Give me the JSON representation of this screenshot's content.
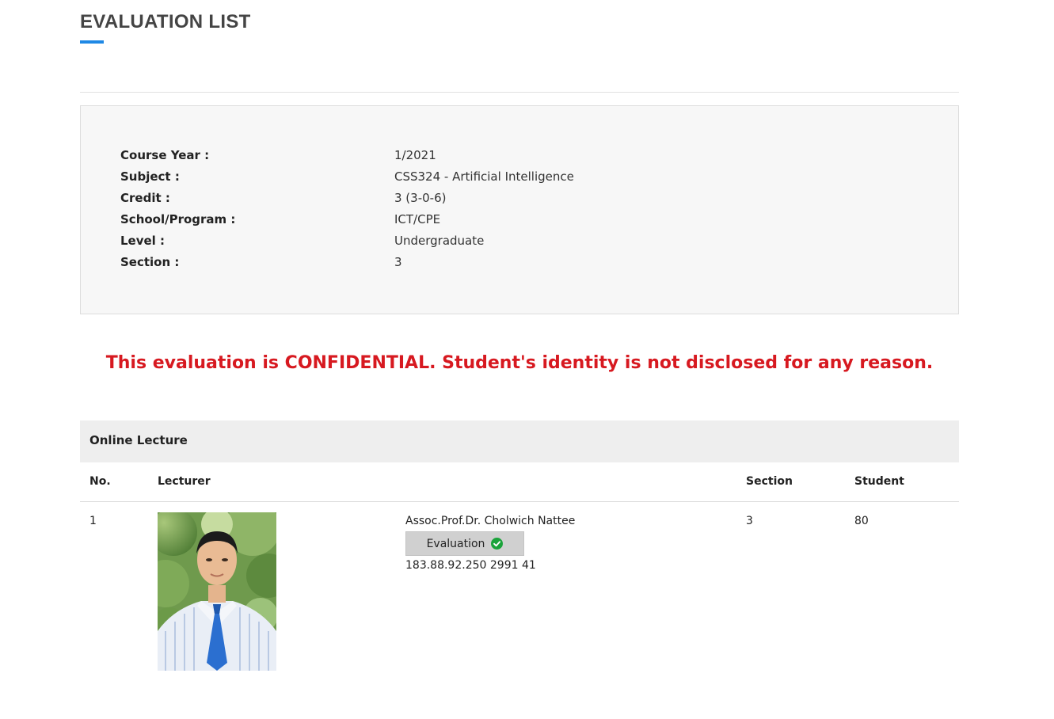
{
  "page": {
    "title": "EVALUATION LIST"
  },
  "course_info": {
    "rows": [
      {
        "label": "Course Year :",
        "value": "1/2021"
      },
      {
        "label": "Subject :",
        "value": "CSS324 - Artificial Intelligence"
      },
      {
        "label": "Credit :",
        "value": "3 (3-0-6)"
      },
      {
        "label": "School/Program :",
        "value": "ICT/CPE"
      },
      {
        "label": "Level :",
        "value": "Undergraduate"
      },
      {
        "label": "Section :",
        "value": "3"
      }
    ]
  },
  "notice": {
    "text": "This evaluation is CONFIDENTIAL. Student's identity is not disclosed for any reason.",
    "color": "#d71920"
  },
  "section": {
    "title": "Online Lecture",
    "columns": {
      "no": "No.",
      "lecturer": "Lecturer",
      "section": "Section",
      "student": "Student"
    },
    "rows": [
      {
        "no": "1",
        "lecturer_name": "Assoc.Prof.Dr. Cholwich Nattee",
        "button_label": "Evaluation",
        "button_icon": "check-circle-icon",
        "meta": "183.88.92.250 2991 41",
        "section": "3",
        "student": "80"
      }
    ]
  },
  "colors": {
    "accent": "#1e88e5",
    "check": "#1aa33a"
  }
}
